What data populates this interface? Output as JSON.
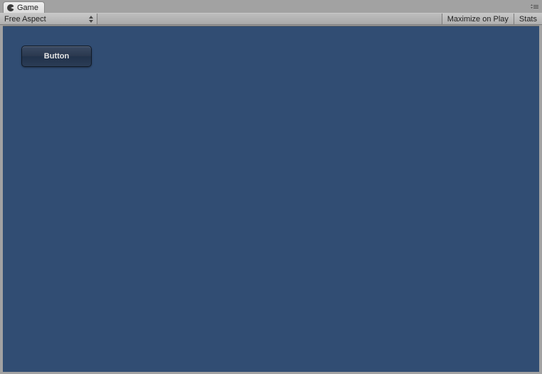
{
  "tab": {
    "label": "Game"
  },
  "toolbar": {
    "aspect_label": "Free Aspect",
    "maximize_label": "Maximize on Play",
    "stats_label": "Stats"
  },
  "game": {
    "button_label": "Button"
  }
}
